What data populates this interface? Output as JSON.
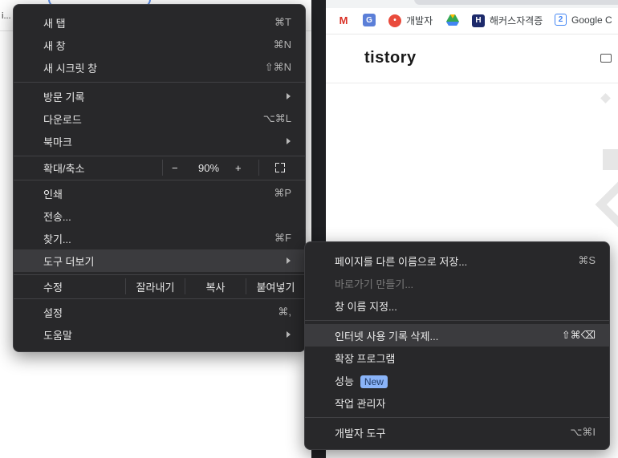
{
  "background": {
    "left_truncated_text": "i...",
    "bookmarks": [
      {
        "label": "",
        "icon": "gmail-icon"
      },
      {
        "label": "",
        "icon": "google-translate-icon"
      },
      {
        "label": "개발자",
        "icon": "red-circle-icon"
      },
      {
        "label": "",
        "icon": "google-drive-icon"
      },
      {
        "label": "해커스자격증",
        "icon": "hackers-h-icon"
      },
      {
        "label": "Google C",
        "icon": "google-calendar-icon"
      }
    ],
    "site_logo": "tistory"
  },
  "main_menu": {
    "new_tab": {
      "label": "새 탭",
      "shortcut": "⌘T"
    },
    "new_window": {
      "label": "새 창",
      "shortcut": "⌘N"
    },
    "new_incognito": {
      "label": "새 시크릿 창",
      "shortcut": "⇧⌘N"
    },
    "history": {
      "label": "방문 기록"
    },
    "downloads": {
      "label": "다운로드",
      "shortcut": "⌥⌘L"
    },
    "bookmarks": {
      "label": "북마크"
    },
    "zoom": {
      "label": "확대/축소",
      "minus": "−",
      "value": "90%",
      "plus": "+"
    },
    "print": {
      "label": "인쇄",
      "shortcut": "⌘P"
    },
    "cast": {
      "label": "전송..."
    },
    "find": {
      "label": "찾기...",
      "shortcut": "⌘F"
    },
    "more_tools": {
      "label": "도구 더보기"
    },
    "edit": {
      "label": "수정",
      "cut": "잘라내기",
      "copy": "복사",
      "paste": "붙여넣기"
    },
    "settings": {
      "label": "설정",
      "shortcut": "⌘,"
    },
    "help": {
      "label": "도움말"
    }
  },
  "sub_menu": {
    "save_page": {
      "label": "페이지를 다른 이름으로 저장...",
      "shortcut": "⌘S"
    },
    "create_shortcut": {
      "label": "바로가기 만들기..."
    },
    "name_window": {
      "label": "창 이름 지정..."
    },
    "clear_data": {
      "label": "인터넷 사용 기록 삭제...",
      "shortcut": "⇧⌘⌫"
    },
    "extensions": {
      "label": "확장 프로그램"
    },
    "performance": {
      "label": "성능",
      "badge": "New"
    },
    "task_manager": {
      "label": "작업 관리자"
    },
    "dev_tools": {
      "label": "개발자 도구",
      "shortcut": "⌥⌘I"
    }
  },
  "colors": {
    "menu_bg": "#28282a",
    "highlight": "#3b3b3e",
    "badge": "#8ab4f8"
  }
}
